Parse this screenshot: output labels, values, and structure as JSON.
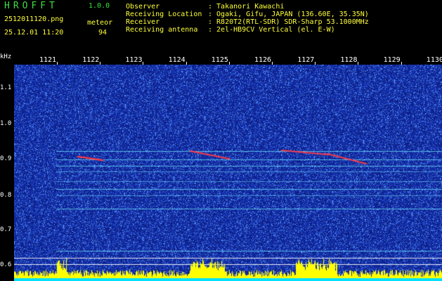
{
  "header": {
    "app_title": "HROFFT",
    "app_version": "1.0.0",
    "file_name": "2512011120.png",
    "mode": "meteor",
    "date_time": "25.12.01 11:20",
    "count": "94",
    "info_labels": "Observer\nReceiving Location\nReceiver\nReceiving antenna",
    "info_values": ": Takanori Kawachi\n: Ogaki, Gifu, JAPAN (136.60E, 35.35N)\n: R820T2(RTL-SDR) SDR-Sharp 53.1000MHz\n: 2el-HB9CV Vertical (el. E-W)"
  },
  "axis": {
    "unit": "kHz",
    "time_ticks": [
      "1121",
      "1122",
      "1123",
      "1124",
      "1125",
      "1126",
      "1127",
      "1128",
      "1129",
      "1130"
    ],
    "freq_ticks": [
      "1.1",
      "1.0",
      "0.9",
      "0.8",
      "0.7",
      "0.6"
    ]
  },
  "colors": {
    "background": "#142ea8",
    "header_green": "#3de03d",
    "header_yellow": "#ffff3a",
    "signal_trace": "#ff3040",
    "power_bar": "#ffff00",
    "power_base": "#00e0ff"
  }
}
